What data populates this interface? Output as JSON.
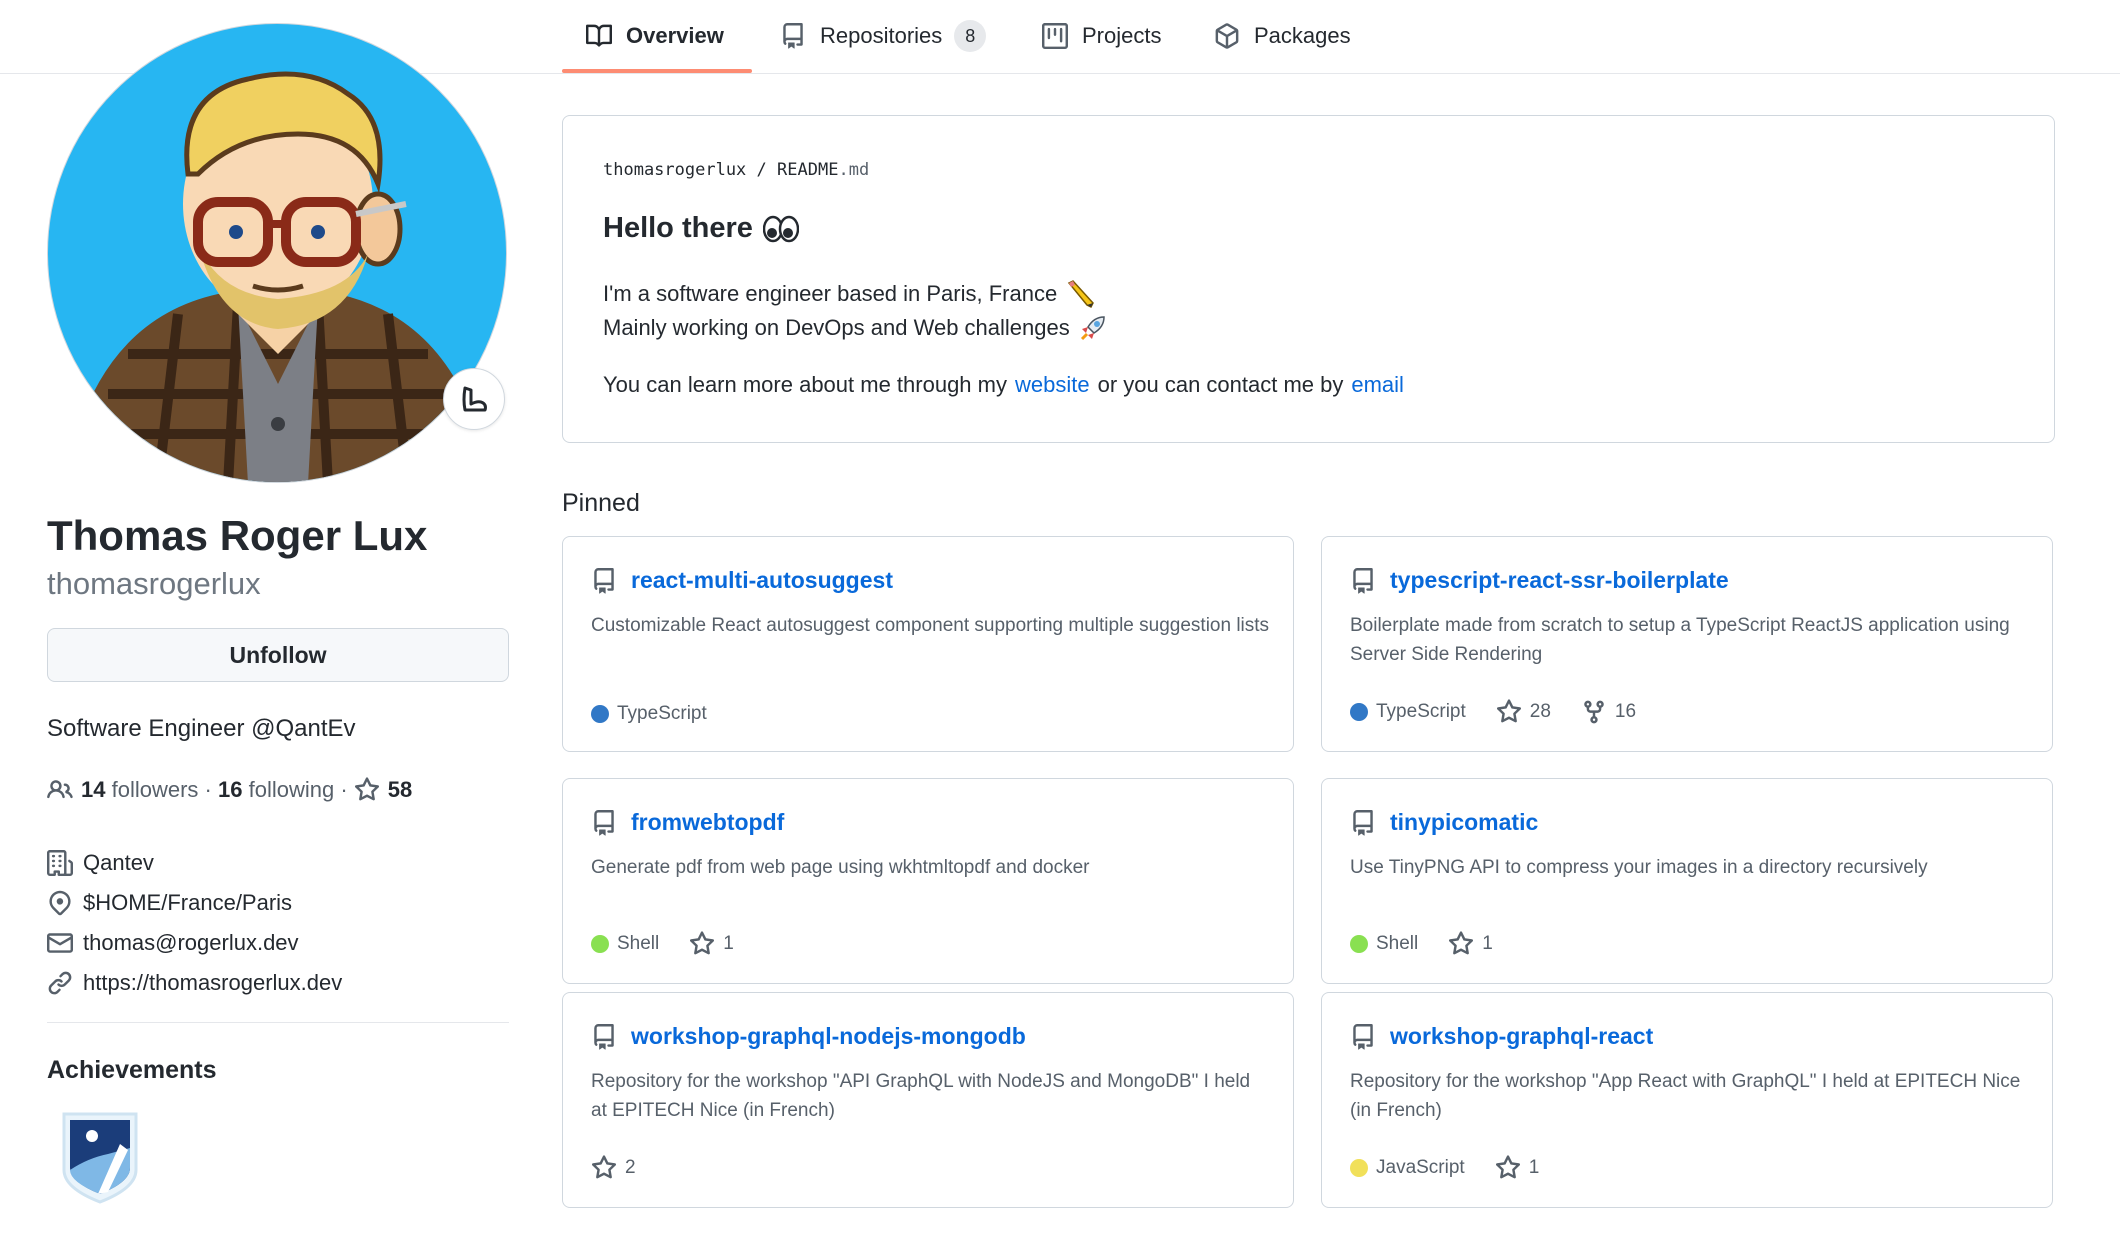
{
  "tabs": [
    {
      "label": "Overview",
      "icon": "book-icon",
      "active": true
    },
    {
      "label": "Repositories",
      "icon": "repo-icon",
      "count": "8"
    },
    {
      "label": "Projects",
      "icon": "project-icon"
    },
    {
      "label": "Packages",
      "icon": "package-icon"
    }
  ],
  "profile": {
    "name": "Thomas Roger Lux",
    "username": "thomasrogerlux",
    "unfollow_label": "Unfollow",
    "bio": "Software Engineer @QantEv",
    "followers_count": "14",
    "followers_label": "followers",
    "following_count": "16",
    "following_label": "following",
    "stars_count": "58",
    "company": "Qantev",
    "location": "$HOME/France/Paris",
    "email": "thomas@rogerlux.dev",
    "website": "https://thomasrogerlux.dev",
    "status_icon": "flexed-biceps-emoji"
  },
  "achievements": {
    "title": "Achievements",
    "badge_icon": "arctic-code-vault-badge"
  },
  "readme": {
    "owner": "thomasrogerlux",
    "separator": "/",
    "file": "README",
    "ext": ".md",
    "heading": "Hello there",
    "heading_emoji": "eyes-emoji",
    "line1": "I'm a software engineer based in Paris, France",
    "line1_emoji": "pencil-emoji",
    "line2": "Mainly working on DevOps and Web challenges",
    "line2_emoji": "rocket-emoji",
    "line3_pre": "You can learn more about me through my",
    "line3_link1": "website",
    "line3_mid": "or you can contact me by",
    "line3_link2": "email"
  },
  "pinned": {
    "title": "Pinned",
    "items": [
      {
        "name": "react-multi-autosuggest",
        "desc": "Customizable React autosuggest component supporting multiple suggestion lists",
        "lang": "TypeScript",
        "lang_color": "#3178c6",
        "stars": "",
        "forks": ""
      },
      {
        "name": "typescript-react-ssr-boilerplate",
        "desc": "Boilerplate made from scratch to setup a TypeScript ReactJS application using Server Side Rendering",
        "lang": "TypeScript",
        "lang_color": "#3178c6",
        "stars": "28",
        "forks": "16"
      },
      {
        "name": "fromwebtopdf",
        "desc": "Generate pdf from web page using wkhtmltopdf and docker",
        "lang": "Shell",
        "lang_color": "#89e051",
        "stars": "1",
        "forks": ""
      },
      {
        "name": "tinypicomatic",
        "desc": "Use TinyPNG API to compress your images in a directory recursively",
        "lang": "Shell",
        "lang_color": "#89e051",
        "stars": "1",
        "forks": ""
      },
      {
        "name": "workshop-graphql-nodejs-mongodb",
        "desc": "Repository for the workshop \"API GraphQL with NodeJS and MongoDB\" I held at EPITECH Nice (in French)",
        "lang": "",
        "lang_color": "",
        "stars": "2",
        "forks": ""
      },
      {
        "name": "workshop-graphql-react",
        "desc": "Repository for the workshop \"App React with GraphQL\" I held at EPITECH Nice (in French)",
        "lang": "JavaScript",
        "lang_color": "#f1e05a",
        "stars": "1",
        "forks": ""
      }
    ]
  }
}
